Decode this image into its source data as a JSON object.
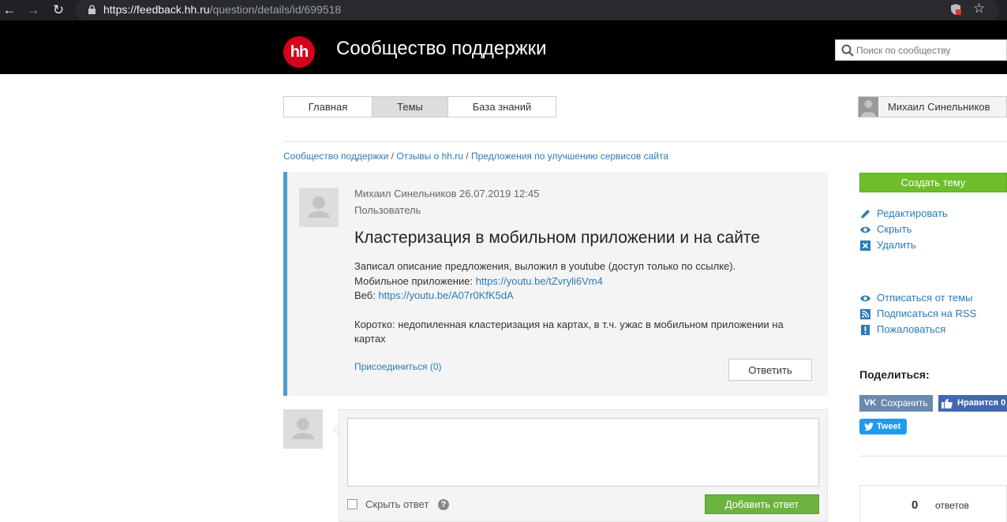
{
  "browser": {
    "url_host": "https://feedback.hh.ru",
    "url_path": "/question/details/id/699518"
  },
  "header": {
    "logo_text": "hh",
    "title": "Сообщество поддержки",
    "search_placeholder": "Поиск по сообществу"
  },
  "tabs": [
    {
      "label": "Главная",
      "active": false
    },
    {
      "label": "Темы",
      "active": true
    },
    {
      "label": "База знаний",
      "active": false
    }
  ],
  "user": {
    "name": "Михаил Синельников"
  },
  "breadcrumb": [
    "Сообщество поддержки",
    "Отзывы о hh.ru",
    "Предложения по улучшению сервисов сайта"
  ],
  "question": {
    "author": "Михаил Синельников",
    "date": "26.07.2019 12:45",
    "role": "Пользователь",
    "title": "Кластеризация в мобильном приложении и на сайте",
    "line1": "Записал описание предложения, выложил в youtube (доступ только по ссылке).",
    "mobile_label": "Мобильное приложение: ",
    "mobile_link": "https://youtu.be/tZvryli6Vm4",
    "web_label": "Веб: ",
    "web_link": "https://youtu.be/A07r0KfK5dA",
    "summary": "Коротко: недопиленная кластеризация на картах, в т.ч. ужас в мобильном приложении на картах",
    "join_label": "Присоединиться (0)",
    "reply_label": "Ответить"
  },
  "answer_form": {
    "hide_label": "Скрыть ответ",
    "help_glyph": "?",
    "submit_label": "Добавить ответ"
  },
  "sidebar": {
    "create_label": "Создать тему",
    "edit_label": "Редактировать",
    "hide_label": "Скрыть",
    "delete_label": "Удалить",
    "unsubscribe_label": "Отписаться от темы",
    "rss_label": "Подписаться на RSS",
    "complain_label": "Пожаловаться",
    "share_title": "Поделиться:",
    "vk_logo": "VK",
    "vk_label": "Сохранить",
    "fb_label": "Нравится 0",
    "tw_label": "Tweet",
    "answers_count": "0",
    "answers_label": "ответов"
  },
  "colors": {
    "brand_red": "#d6001c",
    "link_blue": "#2b7bb9",
    "green": "#6dbe2a",
    "accent_blue": "#4b9ecf"
  }
}
